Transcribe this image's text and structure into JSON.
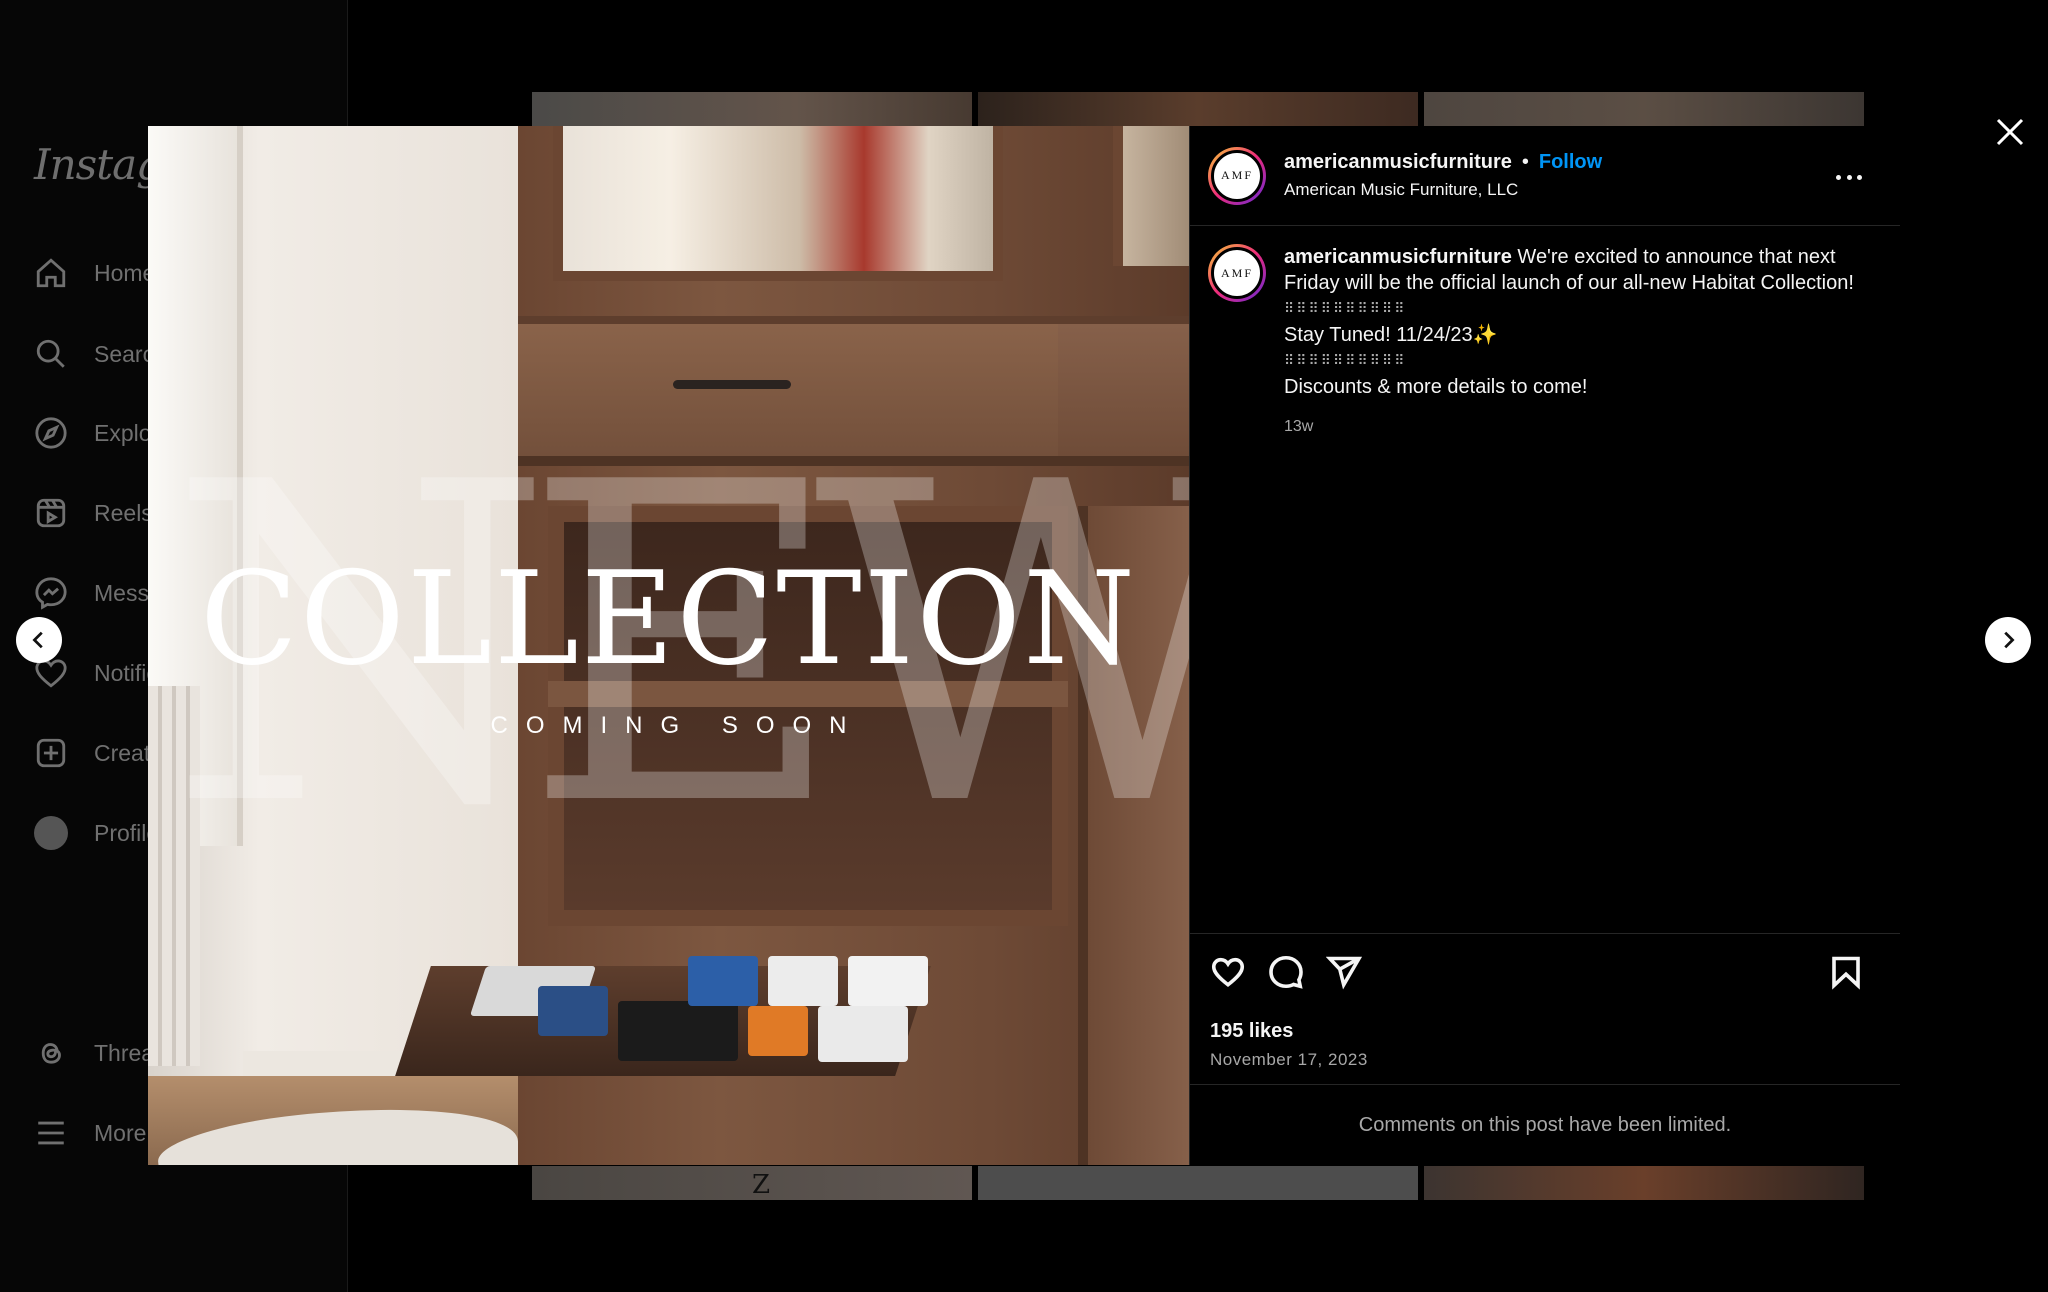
{
  "background": {
    "logo": "Instagram",
    "nav": [
      {
        "label": "Home",
        "icon": "home-icon"
      },
      {
        "label": "Search",
        "icon": "search-icon"
      },
      {
        "label": "Explore",
        "icon": "explore-icon"
      },
      {
        "label": "Reels",
        "icon": "reels-icon"
      },
      {
        "label": "Messages",
        "icon": "messenger-icon"
      },
      {
        "label": "Notifications",
        "icon": "heart-icon"
      },
      {
        "label": "Create",
        "icon": "create-icon"
      },
      {
        "label": "Profile",
        "icon": "profile-avatar"
      },
      {
        "label": "Threads",
        "icon": "threads-icon"
      },
      {
        "label": "More",
        "icon": "menu-icon"
      }
    ]
  },
  "media": {
    "overlay_large": "NEW",
    "title": "COLLECTION",
    "subtitle": "COMING SOON"
  },
  "post": {
    "avatar_text": "AMF",
    "username": "americanmusicfurniture",
    "separator": "•",
    "follow_label": "Follow",
    "account_subtitle": "American Music Furniture, LLC",
    "caption_user": "americanmusicfurniture",
    "caption_lines": [
      "We're excited to announce that next Friday will be the official launch of our all-new Habitat Collection!",
      "⠿⠿⠿⠿⠿⠿⠿⠿⠿⠿",
      "Stay Tuned! 11/24/23✨",
      "⠿⠿⠿⠿⠿⠿⠿⠿⠿⠿",
      "Discounts & more details to come!"
    ],
    "caption_age": "13w",
    "likes": "195 likes",
    "date": "November 17, 2023",
    "comments_notice": "Comments on this post have been limited."
  },
  "colors": {
    "follow": "#0095f6",
    "background": "#000000"
  }
}
